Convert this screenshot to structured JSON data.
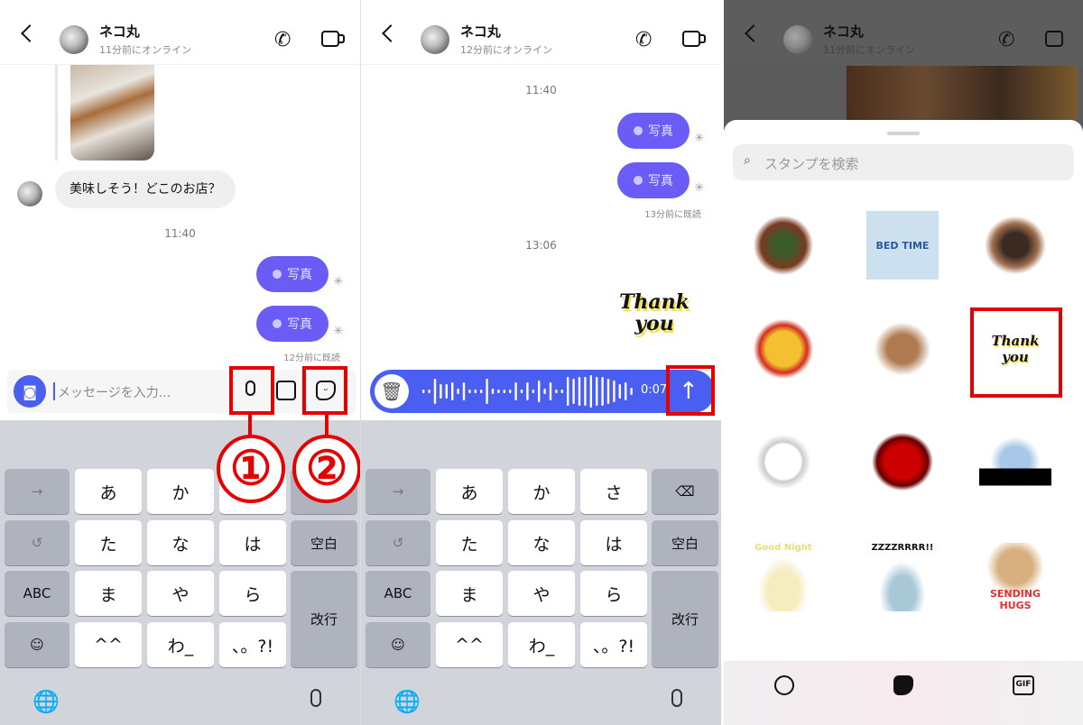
{
  "contact": {
    "name": "ネコ丸"
  },
  "panel1": {
    "status": "11分前にオンライン",
    "incoming_message": "美味しそう！どこのお店？",
    "time": "11:40",
    "photo_label": "写真",
    "read_status": "12分前に既読",
    "input_placeholder": "メッセージを入力...",
    "markers": [
      "①",
      "②"
    ]
  },
  "panel2": {
    "status": "12分前にオンライン",
    "time1": "11:40",
    "photo_label": "写真",
    "read_status": "13分前に既読",
    "time2": "13:06",
    "sticker_text": "Thank you",
    "recording_duration": "0:07"
  },
  "panel3": {
    "status": "11分前にオンライン",
    "search_placeholder": "スタンプを検索",
    "stickers": [
      "",
      "BED TIME",
      "",
      "",
      "",
      "Thank you",
      "",
      "",
      "",
      "Good Night",
      "ZZZZRRRR!!",
      "SENDING HUGS"
    ],
    "tabs": [
      "emoji-tab",
      "sticker-tab",
      "GIF"
    ]
  },
  "keyboard1": {
    "rows": [
      [
        "→",
        "あ",
        "か",
        "さ",
        ""
      ],
      [
        "↺",
        "た",
        "な",
        "は",
        "空白"
      ],
      [
        "ABC",
        "ま",
        "や",
        "ら",
        "改行"
      ],
      [
        "☺",
        "^^",
        "わ_",
        "、。?!"
      ]
    ]
  },
  "keyboard2": {
    "rows": [
      [
        "→",
        "あ",
        "か",
        "さ",
        "⌫"
      ],
      [
        "↺",
        "た",
        "な",
        "は",
        "空白"
      ],
      [
        "ABC",
        "ま",
        "や",
        "ら",
        "改行"
      ],
      [
        "☺",
        "^^",
        "わ_",
        "、。?!"
      ]
    ]
  },
  "colors": {
    "accent": "#6b5cf6",
    "input_blue": "#4a5ff2",
    "annotation_red": "#e60000"
  }
}
